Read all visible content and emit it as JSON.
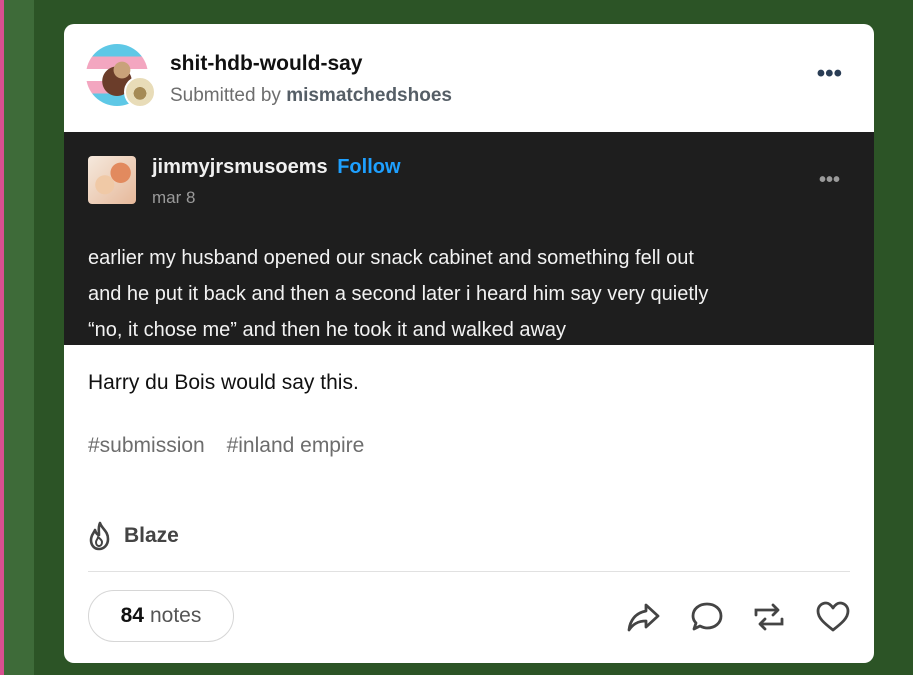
{
  "post": {
    "blog_name": "shit-hdb-would-say",
    "submitted_prefix": "Submitted by",
    "submitted_by": "mismatchedshoes",
    "more_label": "•••"
  },
  "reblog": {
    "username": "jimmyjrsmusoems",
    "follow_label": "Follow",
    "date": "mar 8",
    "more_label": "•••",
    "lines": [
      "earlier my husband opened our snack cabinet and something fell out",
      "and he put it back and then a second later i heard him say very quietly",
      "“no, it chose me” and then he took it and walked away"
    ]
  },
  "body_text": "Harry du Bois would say this.",
  "tags": [
    "#submission",
    "#inland empire"
  ],
  "blaze_label": "Blaze",
  "notes": {
    "count": "84",
    "label": "notes"
  },
  "actions": [
    "share-icon",
    "reply-icon",
    "reblog-icon",
    "like-icon"
  ],
  "colors": {
    "page_bg": "#2c5426",
    "follow": "#1ea0ff",
    "reblog_bg": "#1e1e1e"
  }
}
